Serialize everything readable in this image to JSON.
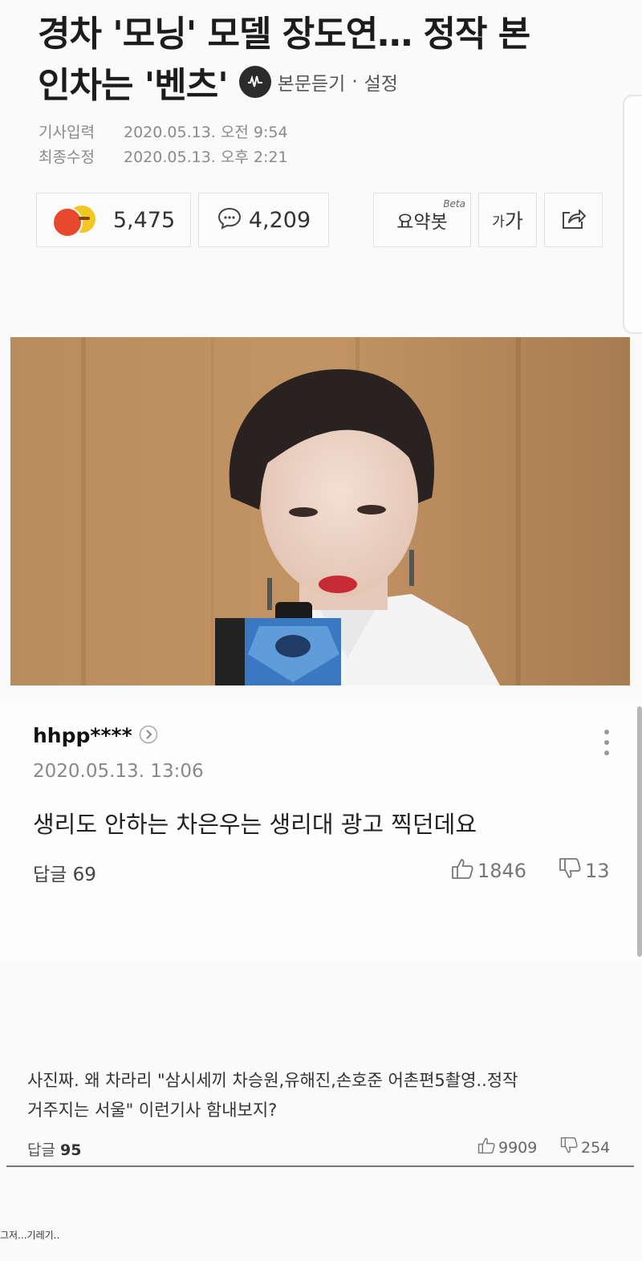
{
  "article": {
    "title_line1": "경차 '모닝' 모델 장도연… 정작 본",
    "title_line2": "인차는 '벤츠'",
    "tts_label": "본문듣기",
    "sep": "·",
    "settings_label": "설정",
    "input_label": "기사입력",
    "input_time": "2020.05.13. 오전 9:54",
    "edit_label": "최종수정",
    "edit_time": "2020.05.13. 오후 2:21",
    "reaction_count": "5,475",
    "comment_count": "4,209",
    "summary_bot_label": "요약봇",
    "beta_label": "Beta",
    "font_size_label_small": "가",
    "font_size_label_large": "가"
  },
  "comment1": {
    "nickname": "hhpp****",
    "date": "2020.05.13. 13:06",
    "text": "생리도 안하는 차은우는 생리대 광고 찍던데요",
    "reply_label": "답글 69",
    "likes": "1846",
    "dislikes": "13"
  },
  "comment2": {
    "line1": "사진짜. 왜 차라리 \"삼시세끼 차승원,유해진,손호준 어촌편5촬영..정작",
    "line2": "거주지는 서울\" 이런기사 함내보지?",
    "reply_prefix": "답글",
    "reply_count": "95",
    "likes": "9909",
    "dislikes": "254"
  },
  "caption": "그저...기레기..",
  "colors": {
    "angry": "#e8492d",
    "smile": "#f3c623",
    "text_dark": "#1c1c1c",
    "muted": "#8a8a8a"
  }
}
